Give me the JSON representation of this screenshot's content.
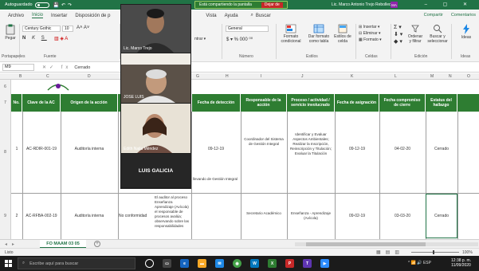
{
  "titlebar": {
    "autosave_label": "Autoguardado",
    "share_banner": "Está compartiendo la pantalla",
    "stop_share": "Dejar de",
    "user_name": "Lic. Marco Antonio Trejo Rebolledo",
    "user_initials": "MA",
    "window_controls": "–  ▢  ✕"
  },
  "ribbon_tabs": {
    "items": [
      "Archivo",
      "Inicio",
      "Insertar",
      "Disposición de p",
      "Vista",
      "Ayuda"
    ],
    "active": "Inicio",
    "search_label": "Buscar",
    "share_button": "Compartir",
    "comments_button": "Comentarios"
  },
  "ribbon": {
    "paste_label": "Pegar",
    "font_name": "Century Gothic",
    "font_size": "10",
    "number_format": "General",
    "insert_label": "Insertar",
    "delete_label": "Eliminar",
    "format_label": "Formato",
    "conditional_format": "Formato condicional",
    "format_as_table": "Dar formato como tabla",
    "cell_styles": "Estilos de celda",
    "sort_filter": "Ordenar y filtrar",
    "find_select": "Buscar y seleccionar",
    "ideas": "Ideas",
    "groups": {
      "clipboard": "Portapapeles",
      "font": "Fuente",
      "number": "Número",
      "styles": "Estilos",
      "cells": "Celdas",
      "editing": "Edición",
      "ideas": "Ideas"
    }
  },
  "formula_bar": {
    "name_box": "M9",
    "content": "Cerrado"
  },
  "columns": [
    "B",
    "C",
    "D",
    "E",
    "F",
    "G",
    "H",
    "I",
    "J",
    "K",
    "L",
    "M",
    "N",
    "O"
  ],
  "rows": [
    "6",
    "7",
    "8",
    "9"
  ],
  "table": {
    "headers": [
      "No.",
      "Clave de la AC",
      "Origen de la acción",
      "Fecha de detección",
      "Responsable de la acción",
      "Proceso / actividad / servicio involucrado",
      "Fecha de asignación",
      "Fecha compromiso de cierre",
      "Estatus del hallazgo"
    ],
    "rows": [
      {
        "no": "1",
        "clave": "AC-RDIR-001-19",
        "origen": "Auditoría interna",
        "fecha_deteccion": "09-12-19",
        "responsable": "Coordinador del Sistema de Gestión Integral",
        "proceso": "Identificar y Evaluar Aspectos Ambientales; Realizar la Inscripción, Reinscripción y Titulación; Evaluar la Titulación",
        "fecha_asignacion": "09-12-19",
        "fecha_compromiso": "04-02-20",
        "estatus": "Cerrado"
      },
      {
        "no": "2",
        "clave": "AC-RFBA-002-19",
        "origen": "Auditoría interna",
        "tipo": "No conformidad",
        "fecha_deteccion": "",
        "responsable": "Secretario Académico",
        "proceso": "Enseñanza - Aprendizaje (Avícola)",
        "fecha_asignacion": "09-02-19",
        "fecha_compromiso": "03-03-20",
        "estatus": "Cerrado"
      }
    ],
    "overflow_text_row1": "llevando de Gestión Integral",
    "overflow_text_row2": "El auditor al proceso Enseñanza Aprendizaje (Avícola) el responsable de procesos avalúa; observando sobre las responsabilidades"
  },
  "video_call": {
    "participants": [
      "Lic. Marco Trejo",
      "JOSE LUIS",
      "Edith Naila Méndez"
    ],
    "presenter": "LUIS GALICIA"
  },
  "sheet": {
    "active_tab": "FO MAAM 03 05",
    "status": "Listo",
    "zoom": "100%"
  },
  "taskbar": {
    "search_placeholder": "Escribe aquí para buscar",
    "language": "ESP",
    "time": "12:38 p. m.",
    "date": "11/09/2020"
  }
}
